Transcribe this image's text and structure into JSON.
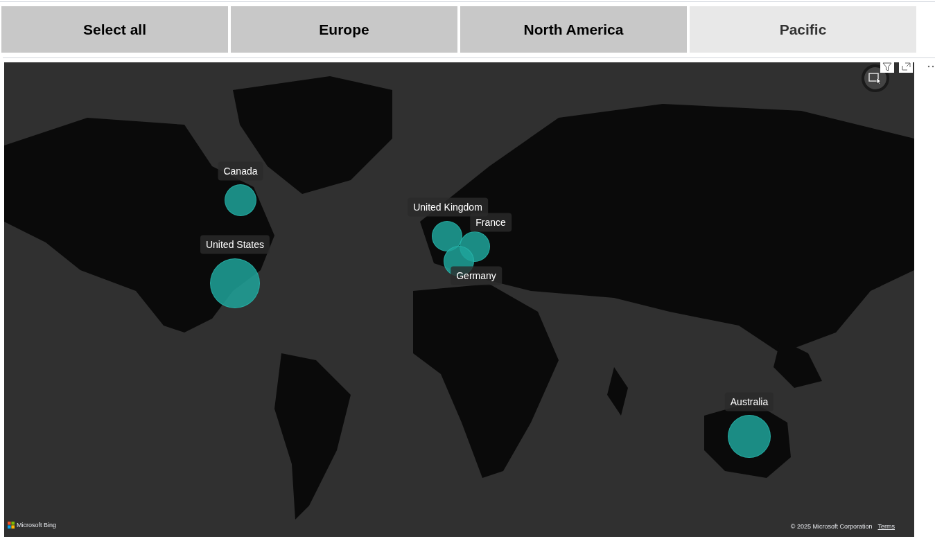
{
  "slicer": {
    "buttons": [
      {
        "label": "Select all",
        "selected": true
      },
      {
        "label": "Europe",
        "selected": true
      },
      {
        "label": "North America",
        "selected": true
      },
      {
        "label": "Pacific",
        "selected": false
      }
    ]
  },
  "map": {
    "bubbles": [
      {
        "label": "Canada"
      },
      {
        "label": "United States"
      },
      {
        "label": "United Kingdom"
      },
      {
        "label": "France"
      },
      {
        "label": "Germany"
      },
      {
        "label": "Australia"
      }
    ],
    "attribution": {
      "logo": "Microsoft Bing",
      "copyright": "© 2025 Microsoft Corporation",
      "terms": "Terms"
    }
  }
}
